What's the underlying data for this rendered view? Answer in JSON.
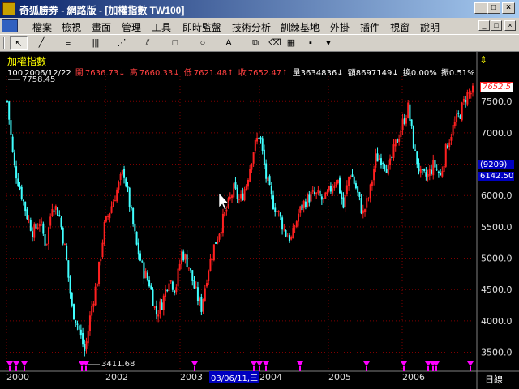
{
  "window": {
    "title": "奇狐勝券 - 網路版 - [加權指數 TW100]"
  },
  "title_buttons": {
    "minimize": "_",
    "restore": "□",
    "close": "×"
  },
  "menu": {
    "items": [
      "檔案",
      "檢視",
      "畫面",
      "管理",
      "工具",
      "即時監盤",
      "技術分析",
      "訓練基地",
      "外掛",
      "插件",
      "視窗",
      "說明"
    ]
  },
  "mdi_buttons": {
    "minimize": "_",
    "restore": "□",
    "close": "×"
  },
  "toolbar": {
    "tools": [
      {
        "name": "select-arrow-tool",
        "icon": "↖"
      },
      {
        "name": "trendline-tool",
        "icon": "╱"
      },
      {
        "name": "horizontal-line-tool",
        "icon": "≡"
      },
      {
        "name": "vertical-line-tool",
        "icon": "|||"
      },
      {
        "name": "fan-line-tool",
        "icon": "⋰"
      },
      {
        "name": "parallel-line-tool",
        "icon": "⫽"
      },
      {
        "name": "rectangle-tool",
        "icon": "□"
      },
      {
        "name": "ellipse-tool",
        "icon": "○"
      },
      {
        "name": "text-tool",
        "icon": "A"
      },
      {
        "name": "copy-tool",
        "icon": "⧉"
      },
      {
        "name": "eraser-tool",
        "icon": "⌫"
      },
      {
        "name": "color-palette-tool",
        "icon": "▦"
      },
      {
        "name": "save-tool",
        "icon": "▪"
      }
    ]
  },
  "chart": {
    "symbol_title": "加權指數",
    "info": {
      "period": "100",
      "date": "2006/12/22",
      "open_label": "開",
      "open": "7636.73",
      "high_label": "高",
      "high": "7660.33",
      "low_label": "低",
      "low": "7621.48",
      "close_label": "收",
      "close": "7652.47",
      "volume_label": "量",
      "volume": "3634836",
      "amount_label": "額",
      "amount": "8697149",
      "turnover_label": "換",
      "turnover": "0.00%",
      "amplitude_label": "振",
      "amplitude": "0.51%",
      "down_arrow": "↓",
      "up_arrow": "↑"
    },
    "max_label": "7758.45",
    "min_label": "3411.68",
    "current_price_badge": "7652.5",
    "cursor_badge_count": "(9209)",
    "cursor_badge_price": "6142.50",
    "date_tooltip": "03/06/11,三",
    "period_label": "日線",
    "y_ticks": [
      "7500.0",
      "7000.0",
      "6500.0",
      "6000.0",
      "5500.0",
      "5000.0",
      "4500.0",
      "4000.0",
      "3500.0"
    ],
    "x_ticks": [
      "2000",
      "2002",
      "2003",
      "2004",
      "2005",
      "2006"
    ],
    "colors": {
      "up": "#ff2020",
      "down": "#40ffff",
      "grid": "#800000",
      "title": "#ffff00",
      "marker": "#ff00ff",
      "axis": "#808080"
    }
  },
  "chart_data": {
    "type": "candlestick",
    "title": "加權指數",
    "y_ticks": [
      7500,
      7000,
      6500,
      6000,
      5500,
      5000,
      4500,
      4000,
      3500
    ],
    "x_ticks": [
      "2000",
      "2002",
      "2003",
      "2004",
      "2005",
      "2006"
    ],
    "ylim": [
      3300,
      7800
    ],
    "grid": true,
    "series": [
      {
        "name": "加權指數",
        "close_path": [
          7500,
          6500,
          6100,
          5700,
          5400,
          5600,
          5200,
          5900,
          5700,
          5100,
          4200,
          3900,
          3500,
          4200,
          4700,
          5500,
          5800,
          6100,
          6400,
          5800,
          5200,
          4800,
          4600,
          4100,
          4300,
          4700,
          4500,
          5100,
          4900,
          4500,
          4200,
          4800,
          5200,
          5500,
          5800,
          6100,
          5900,
          6200,
          6700,
          7000,
          6300,
          5900,
          5700,
          5400,
          5300,
          5700,
          5900,
          6000,
          6000,
          5900,
          6100,
          6300,
          5800,
          6400,
          6100,
          5700,
          6000,
          6600,
          6600,
          6400,
          6800,
          7100,
          7400,
          6700,
          6300,
          6300,
          6500,
          6300,
          6800,
          7100,
          7300,
          7600,
          7650
        ]
      }
    ]
  }
}
